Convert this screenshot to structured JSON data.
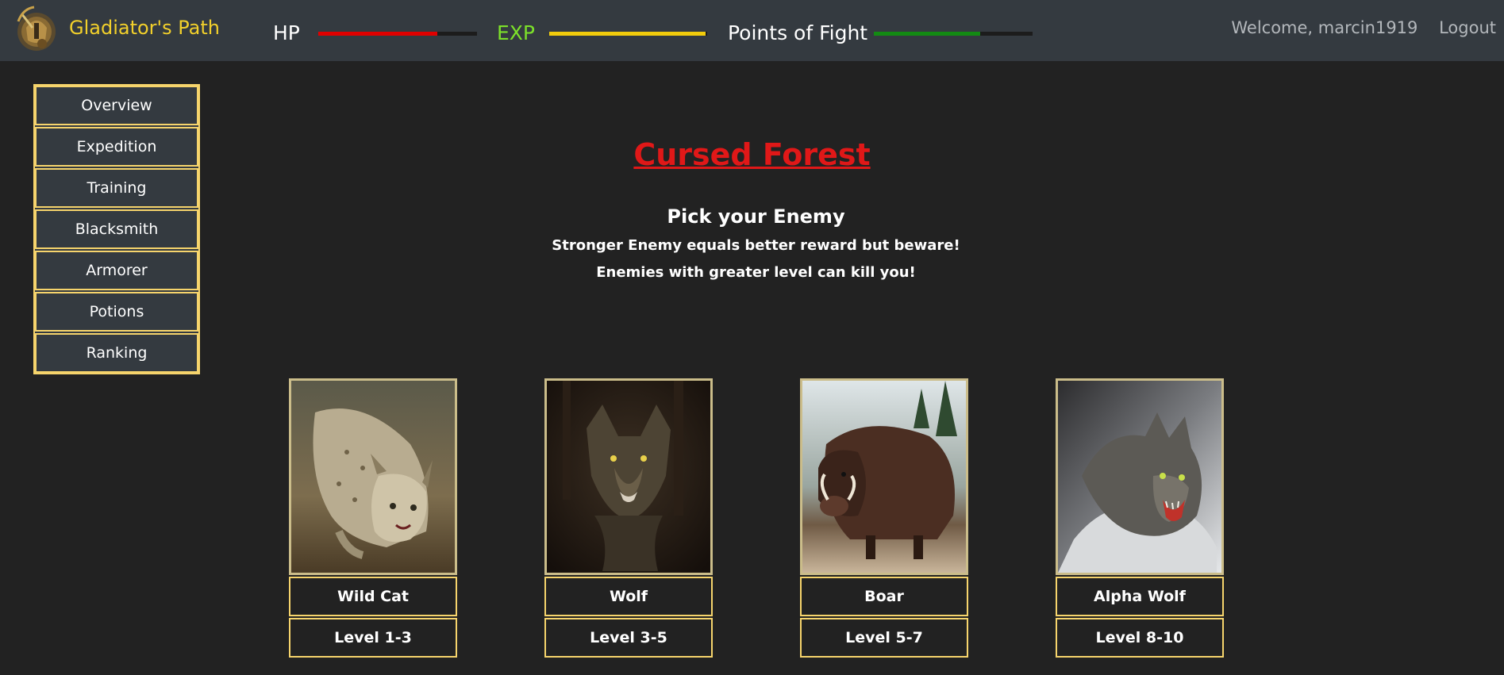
{
  "app": {
    "brand": "Gladiator's Path",
    "logo_icon": "gladiator-helmet-logo"
  },
  "stats": {
    "hp": {
      "label": "HP",
      "fraction": 0.75,
      "color": "#e00000",
      "label_color": "#ffffff"
    },
    "exp": {
      "label": "EXP",
      "fraction": 0.99,
      "color": "#f2cc0c",
      "label_color": "#7ce02a"
    },
    "fight": {
      "label": "Points of Fight",
      "fraction": 0.67,
      "color": "#138a13",
      "label_color": "#ffffff"
    }
  },
  "user": {
    "welcome": "Welcome, marcin1919",
    "logout": "Logout"
  },
  "sidebar": {
    "items": [
      {
        "label": "Overview"
      },
      {
        "label": "Expedition"
      },
      {
        "label": "Training"
      },
      {
        "label": "Blacksmith"
      },
      {
        "label": "Armorer"
      },
      {
        "label": "Potions"
      },
      {
        "label": "Ranking"
      }
    ]
  },
  "main": {
    "title": "Cursed Forest",
    "subtitle": "Pick your Enemy",
    "info_line_1": "Stronger Enemy equals better reward but beware!",
    "info_line_2": "Enemies with greater level can kill you!"
  },
  "enemies": [
    {
      "name": "Wild Cat",
      "level": "Level 1-3",
      "image": "lynx-portrait"
    },
    {
      "name": "Wolf",
      "level": "Level 3-5",
      "image": "wolf-portrait"
    },
    {
      "name": "Boar",
      "level": "Level 5-7",
      "image": "boar-portrait"
    },
    {
      "name": "Alpha Wolf",
      "level": "Level 8-10",
      "image": "alpha-wolf-portrait"
    }
  ],
  "colors": {
    "accent_gold": "#f6d46c",
    "title_red": "#e01818",
    "background": "#222222",
    "topbar": "#343a40"
  }
}
